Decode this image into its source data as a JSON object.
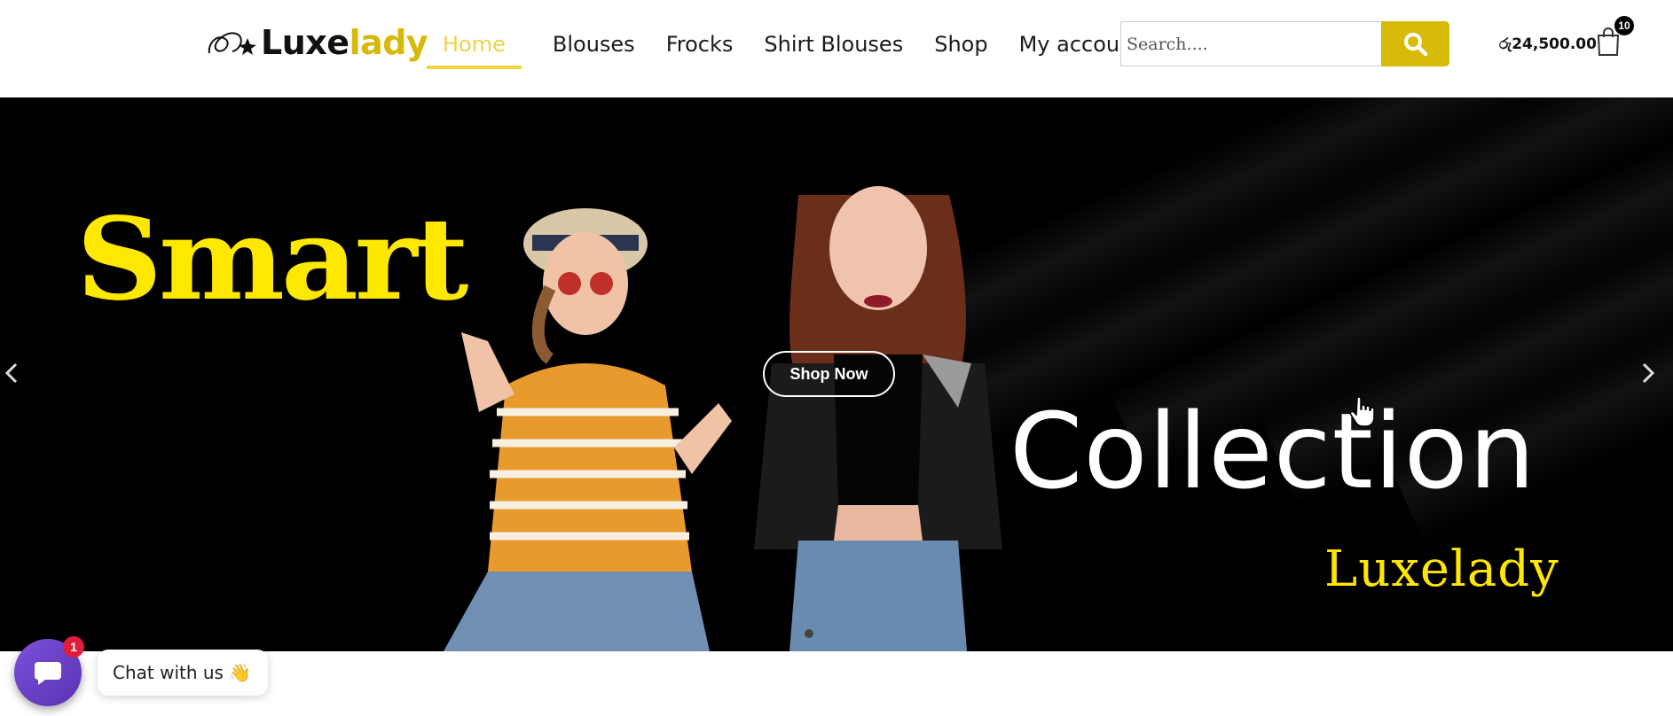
{
  "brand": {
    "part1": "Luxe",
    "part2": "lady"
  },
  "nav": {
    "items": [
      {
        "label": "Home",
        "active": true
      },
      {
        "label": "Blouses"
      },
      {
        "label": "Frocks"
      },
      {
        "label": "Shirt Blouses"
      },
      {
        "label": "Shop"
      },
      {
        "label": "My account"
      }
    ]
  },
  "search": {
    "placeholder": "Search...."
  },
  "cart": {
    "total": "රු24,500.00",
    "count": "10"
  },
  "hero": {
    "headline_1": "Smart",
    "headline_2": "Collection",
    "brand": "Luxelady",
    "cta": "Shop Now"
  },
  "chat": {
    "label": "Chat with us 👋",
    "badge": "1"
  },
  "colors": {
    "accent": "#d8ba08",
    "nav_active": "#efd43d",
    "headline": "#ffe800"
  }
}
